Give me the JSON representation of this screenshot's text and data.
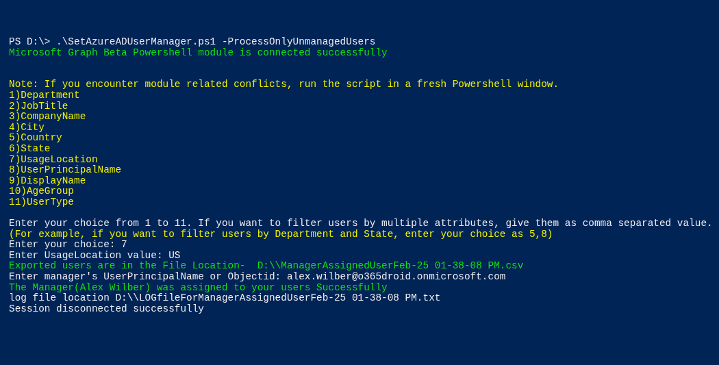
{
  "console": {
    "blocks": [
      {
        "lines": [
          {
            "text": "PS D:\\> .\\SetAzureADUserManager.ps1 -ProcessOnlyUnmanagedUsers",
            "color": "#eeedf0"
          },
          {
            "text": "Microsoft Graph Beta Powershell module is connected successfully",
            "color": "#13e013"
          }
        ]
      },
      {
        "lines": [
          {
            "text": "Note: If you encounter module related conflicts, run the script in a fresh Powershell window.",
            "color": "#f0f000"
          },
          {
            "text": "1)Department",
            "color": "#f0f000"
          },
          {
            "text": "2)JobTitle",
            "color": "#f0f000"
          },
          {
            "text": "3)CompanyName",
            "color": "#f0f000"
          },
          {
            "text": "4)City",
            "color": "#f0f000"
          },
          {
            "text": "5)Country",
            "color": "#f0f000"
          },
          {
            "text": "6)State",
            "color": "#f0f000"
          },
          {
            "text": "7)UsageLocation",
            "color": "#f0f000"
          },
          {
            "text": "8)UserPrincipalName",
            "color": "#f0f000"
          },
          {
            "text": "9)DisplayName",
            "color": "#f0f000"
          },
          {
            "text": "10)AgeGroup",
            "color": "#f0f000"
          },
          {
            "text": "11)UserType",
            "color": "#f0f000"
          }
        ]
      },
      {
        "lines": [
          {
            "text": "Enter your choice from 1 to 11. If you want to filter users by multiple attributes, give them as comma separated value.",
            "color": "#eeedf0"
          },
          {
            "text": "(For example, if you want to filter users by Department and State, enter your choice as 5,8)",
            "color": "#f0f000"
          },
          {
            "text": "Enter your choice: 7",
            "color": "#eeedf0"
          },
          {
            "text": "Enter UsageLocation value: US",
            "color": "#eeedf0"
          },
          {
            "text": "Exported users are in the File Location-  D:\\\\ManagerAssignedUserFeb-25 01-38-08 PM.csv",
            "color": "#13e013"
          },
          {
            "text": "Enter manager's UserPrincipalName or Objectid: alex.wilber@o365droid.onmicrosoft.com",
            "color": "#eeedf0"
          },
          {
            "text": "The Manager(Alex Wilber) was assigned to your users Successfully",
            "color": "#13e013"
          },
          {
            "text": "log file location D:\\\\LOGfileForManagerAssignedUserFeb-25 01-38-08 PM.txt",
            "color": "#eeedf0"
          },
          {
            "text": "Session disconnected successfully",
            "color": "#eeedf0"
          }
        ]
      }
    ]
  }
}
